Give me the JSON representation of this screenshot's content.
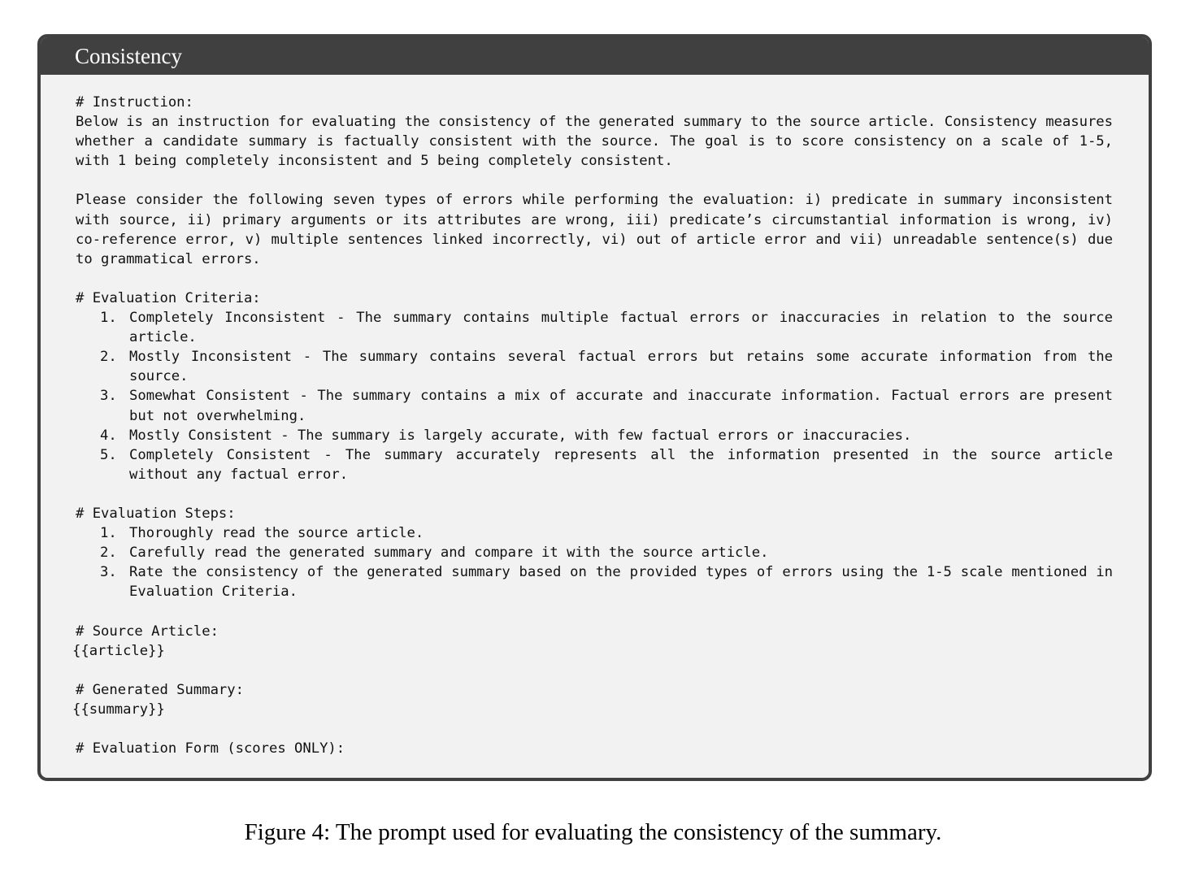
{
  "box": {
    "title": "Consistency"
  },
  "instruction": {
    "heading": "# Instruction:",
    "paragraph1": "Below is an instruction for evaluating the consistency of the generated summary to the source article. Consistency measures whether a candidate summary is factually consistent with the source. The goal is to score consistency on a scale of 1-5, with 1 being completely inconsistent and 5 being completely consistent.",
    "paragraph2": "Please consider the following seven types of errors while performing the evaluation: i) predicate in summary inconsistent with source, ii) primary arguments or its attributes are wrong, iii) predicate’s circumstantial information is wrong, iv) co-reference error, v) multiple sentences linked incorrectly, vi) out of article error and vii) unreadable sentence(s) due to grammatical errors."
  },
  "criteria": {
    "heading": "# Evaluation Criteria:",
    "items": [
      {
        "num": "1.",
        "text": "Completely Inconsistent - The summary contains multiple factual errors or inaccuracies in relation to the source article."
      },
      {
        "num": "2.",
        "text": "Mostly Inconsistent - The summary contains several factual errors but retains some accurate information from the source."
      },
      {
        "num": "3.",
        "text": "Somewhat Consistent - The summary contains a mix of accurate and inaccurate information. Factual errors are present but not overwhelming."
      },
      {
        "num": "4.",
        "text": "Mostly Consistent - The summary is largely accurate, with few factual errors or inaccuracies."
      },
      {
        "num": "5.",
        "text": "Completely Consistent - The summary accurately represents all the information presented in the source article without any factual error."
      }
    ]
  },
  "steps": {
    "heading": "# Evaluation Steps:",
    "items": [
      {
        "num": "1.",
        "text": "Thoroughly read the source article."
      },
      {
        "num": "2.",
        "text": "Carefully read the generated summary and compare it with the source article."
      },
      {
        "num": "3.",
        "text": "Rate the consistency of the generated summary based on the provided types of errors using the 1-5 scale mentioned in Evaluation Criteria."
      }
    ]
  },
  "source": {
    "heading": "# Source Article:",
    "placeholder": "{{article}}"
  },
  "summary": {
    "heading": "# Generated Summary:",
    "placeholder": "{{summary}}"
  },
  "form": {
    "heading": "# Evaluation Form (scores ONLY):"
  },
  "caption": "Figure 4: The prompt used for evaluating the consistency of the summary."
}
